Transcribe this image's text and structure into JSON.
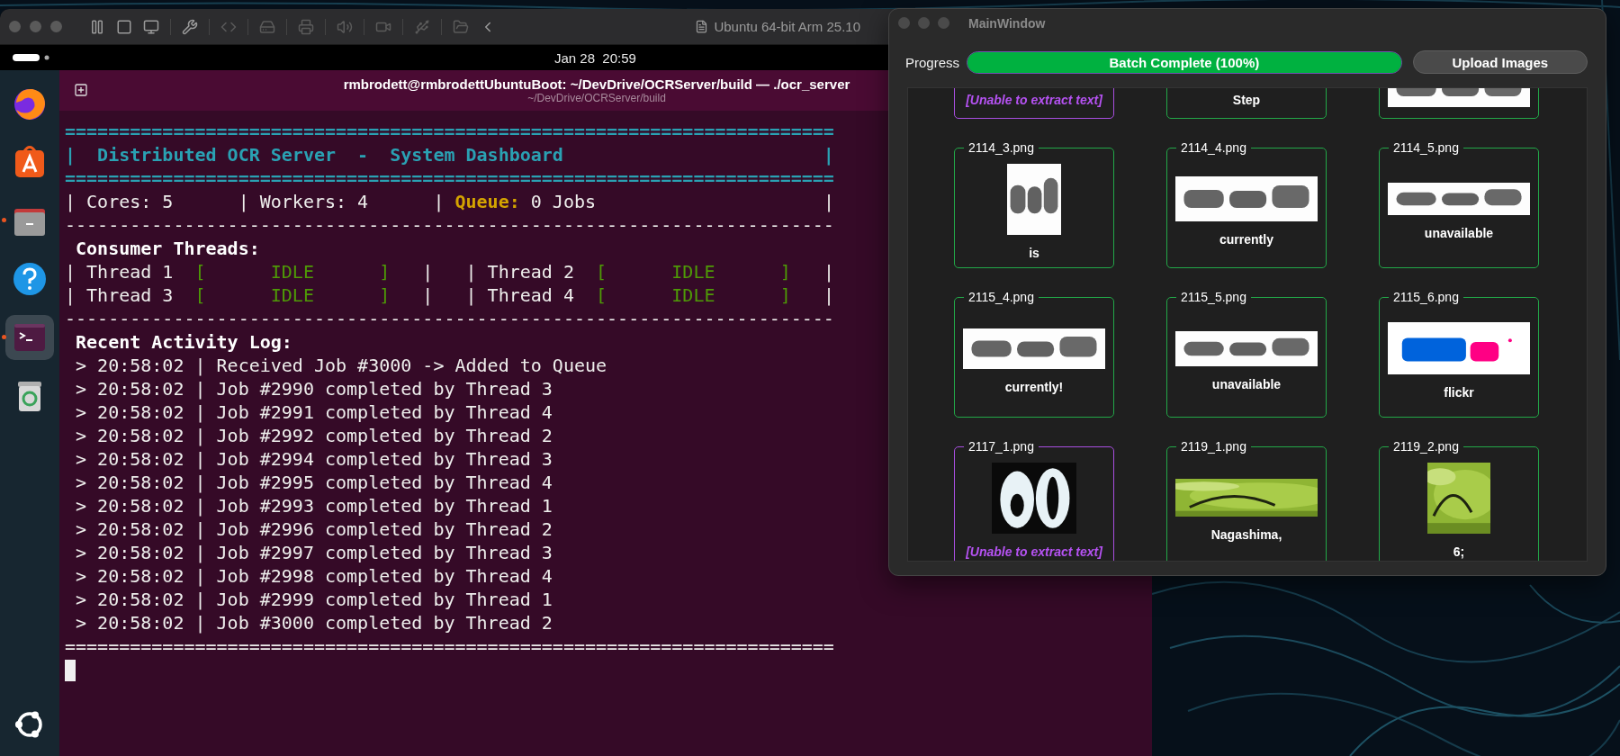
{
  "vm_window": {
    "title": "Ubuntu 64-bit Arm 25.10"
  },
  "top_bar": {
    "clock": "Jan 28  20:59"
  },
  "dock": {
    "items": [
      {
        "kind": "browser",
        "running": false,
        "selected": false
      },
      {
        "kind": "store",
        "running": false,
        "selected": false
      },
      {
        "kind": "files",
        "running": true,
        "selected": false
      },
      {
        "kind": "help",
        "running": false,
        "selected": false
      },
      {
        "kind": "terminal",
        "running": true,
        "selected": true
      },
      {
        "kind": "trash",
        "running": false,
        "selected": false
      },
      {
        "kind": "apps",
        "running": false,
        "selected": false
      }
    ]
  },
  "terminal": {
    "title": "rmbrodett@rmbrodettUbuntuBoot: ~/DevDrive/OCRServer/build — ./ocr_server",
    "subtitle": "~/DevDrive/OCRServer/build",
    "cursor": true,
    "lines": [
      {
        "kind": "banner",
        "text": "======================================================================="
      },
      {
        "kind": "banner",
        "text": "|  Distributed OCR Server  -  System Dashboard                        |"
      },
      {
        "kind": "banner",
        "text": "======================================================================="
      },
      {
        "kind": "stats",
        "segments": [
          {
            "text": "| Cores: 5      | Workers: 4      | ",
            "kind": "plain"
          },
          {
            "text": "Queue:",
            "kind": "warn"
          },
          {
            "text": " 0 Jobs                     |",
            "kind": "plain"
          }
        ]
      },
      {
        "kind": "rule",
        "text": "-----------------------------------------------------------------------"
      },
      {
        "kind": "heading",
        "text": " Consumer Threads:"
      },
      {
        "kind": "threads",
        "segments": [
          {
            "text": "| Thread 1  ",
            "kind": "plain"
          },
          {
            "text": "[      IDLE      ]",
            "kind": "ok"
          },
          {
            "text": "   |   | Thread 2  ",
            "kind": "plain"
          },
          {
            "text": "[      IDLE      ]",
            "kind": "ok"
          },
          {
            "text": "   |",
            "kind": "plain"
          }
        ]
      },
      {
        "kind": "threads",
        "segments": [
          {
            "text": "| Thread 3  ",
            "kind": "plain"
          },
          {
            "text": "[      IDLE      ]",
            "kind": "ok"
          },
          {
            "text": "   |   | Thread 4  ",
            "kind": "plain"
          },
          {
            "text": "[      IDLE      ]",
            "kind": "ok"
          },
          {
            "text": "   |",
            "kind": "plain"
          }
        ]
      },
      {
        "kind": "rule",
        "text": "-----------------------------------------------------------------------"
      },
      {
        "kind": "heading",
        "text": " Recent Activity Log:"
      },
      {
        "kind": "log",
        "text": " > 20:58:02 | Received Job #3000 -> Added to Queue"
      },
      {
        "kind": "log",
        "text": " > 20:58:02 | Job #2990 completed by Thread 3"
      },
      {
        "kind": "log",
        "text": " > 20:58:02 | Job #2991 completed by Thread 4"
      },
      {
        "kind": "log",
        "text": " > 20:58:02 | Job #2992 completed by Thread 2"
      },
      {
        "kind": "log",
        "text": " > 20:58:02 | Job #2994 completed by Thread 3"
      },
      {
        "kind": "log",
        "text": " > 20:58:02 | Job #2995 completed by Thread 4"
      },
      {
        "kind": "log",
        "text": " > 20:58:02 | Job #2993 completed by Thread 1"
      },
      {
        "kind": "log",
        "text": " > 20:58:02 | Job #2996 completed by Thread 2"
      },
      {
        "kind": "log",
        "text": " > 20:58:02 | Job #2997 completed by Thread 3"
      },
      {
        "kind": "log",
        "text": " > 20:58:02 | Job #2998 completed by Thread 4"
      },
      {
        "kind": "log",
        "text": " > 20:58:02 | Job #2999 completed by Thread 1"
      },
      {
        "kind": "log",
        "text": " > 20:58:02 | Job #3000 completed by Thread 2"
      },
      {
        "kind": "rule",
        "text": "======================================================================="
      }
    ]
  },
  "main_window": {
    "title": "MainWindow",
    "progress": {
      "label": "Progress",
      "level": 1,
      "text": "Batch Complete (100%)"
    },
    "upload_button": "Upload Images",
    "cards": [
      {
        "failed": true,
        "result": "[Unable to extract text]"
      },
      {
        "failed": false,
        "result": "Step"
      },
      {
        "failed": false
      },
      {
        "filename": "2114_3.png",
        "failed": false,
        "result": "is"
      },
      {
        "filename": "2114_4.png",
        "failed": false,
        "result": "currently"
      },
      {
        "filename": "2114_5.png",
        "failed": false,
        "result": "unavailable"
      },
      {
        "filename": "2115_4.png",
        "failed": false,
        "result": "currently!"
      },
      {
        "filename": "2115_5.png",
        "failed": false,
        "result": "unavailable"
      },
      {
        "filename": "2115_6.png",
        "failed": false,
        "result": "flickr"
      },
      {
        "filename": "2117_1.png",
        "failed": true,
        "result": "[Unable to extract text]"
      },
      {
        "filename": "2119_1.png",
        "failed": false,
        "result": "Nagashima,"
      },
      {
        "filename": "2119_2.png",
        "failed": false,
        "result": "6;"
      }
    ]
  }
}
